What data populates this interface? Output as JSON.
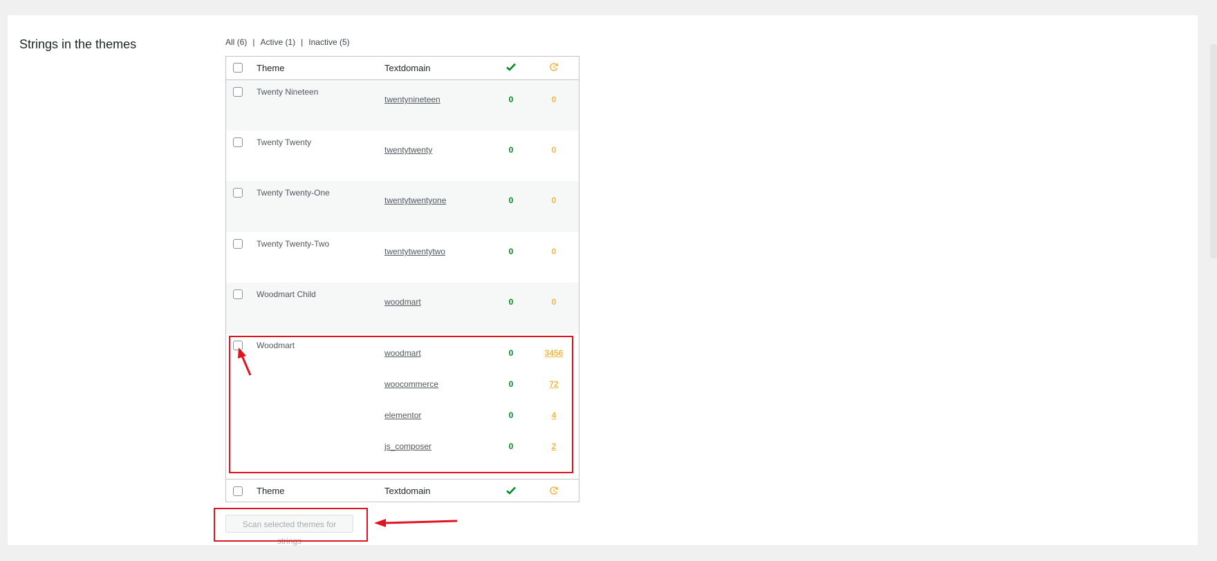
{
  "section": {
    "title": "Strings in the themes"
  },
  "filters": [
    {
      "label": "All (6)"
    },
    {
      "label": "Active (1)"
    },
    {
      "label": "Inactive (5)"
    }
  ],
  "table": {
    "headers": {
      "theme": "Theme",
      "textdomain": "Textdomain",
      "translated_icon": "checkmark-icon",
      "pending_icon": "refresh-icon"
    },
    "rows": [
      {
        "theme": "Twenty Nineteen",
        "domains": [
          {
            "name": "twentynineteen",
            "translated": "0",
            "pending": "0"
          }
        ]
      },
      {
        "theme": "Twenty Twenty",
        "domains": [
          {
            "name": "twentytwenty",
            "translated": "0",
            "pending": "0"
          }
        ]
      },
      {
        "theme": "Twenty Twenty-One",
        "domains": [
          {
            "name": "twentytwentyone",
            "translated": "0",
            "pending": "0"
          }
        ]
      },
      {
        "theme": "Twenty Twenty-Two",
        "domains": [
          {
            "name": "twentytwentytwo",
            "translated": "0",
            "pending": "0"
          }
        ]
      },
      {
        "theme": "Woodmart Child",
        "domains": [
          {
            "name": "woodmart",
            "translated": "0",
            "pending": "0"
          }
        ]
      },
      {
        "theme": "Woodmart",
        "domains": [
          {
            "name": "woodmart",
            "translated": "0",
            "pending": "3456"
          },
          {
            "name": "woocommerce",
            "translated": "0",
            "pending": "72"
          },
          {
            "name": "elementor",
            "translated": "0",
            "pending": "4"
          },
          {
            "name": "js_composer",
            "translated": "0",
            "pending": "2"
          }
        ]
      }
    ]
  },
  "scan_button": {
    "label": "Scan selected themes for strings"
  },
  "colors": {
    "green": "#008a20",
    "orange": "#f0b849",
    "annotation": "#e0141e"
  }
}
